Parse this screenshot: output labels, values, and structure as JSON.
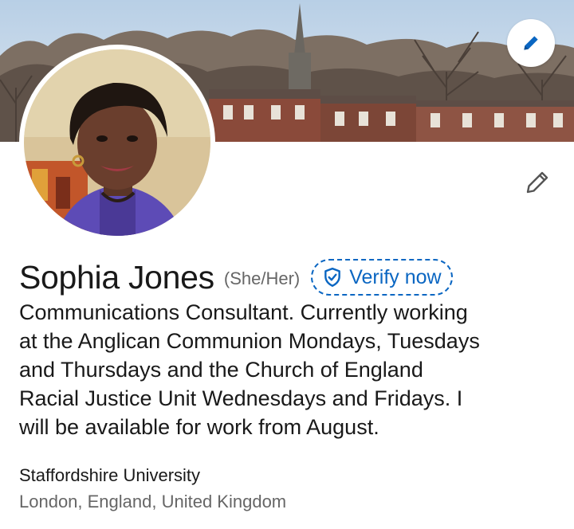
{
  "profile": {
    "name": "Sophia Jones",
    "pronouns": "(She/Her)",
    "verify_label": "Verify now",
    "headline_lines": [
      "Communications Consultant. Currently working",
      "at the Anglican Communion Mondays, Tuesdays",
      "and Thursdays and the Church of England",
      "Racial Justice Unit Wednesdays and Fridays. I",
      "will be available for work from August."
    ],
    "education": "Staffordshire University",
    "location": "London, England, United Kingdom"
  },
  "icons": {
    "banner_edit": "pencil-icon",
    "intro_edit": "pencil-icon",
    "verify": "shield-check-icon"
  },
  "colors": {
    "brand_blue": "#0a66c2",
    "text_primary": "#191919",
    "text_secondary": "#666666"
  }
}
